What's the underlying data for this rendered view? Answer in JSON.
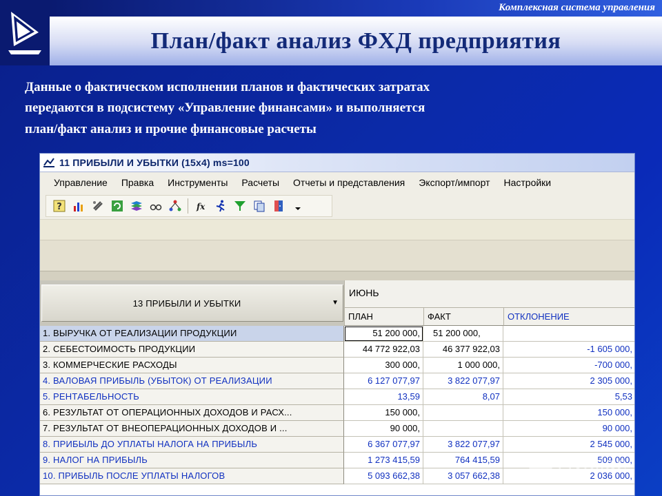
{
  "slide": {
    "tagline": "Комплексная система управления",
    "title": "План/факт анализ  ФХД предприятия",
    "intro": [
      "Данные о фактическом исполнении планов и фактических затратах",
      "передаются в подсистему «Управление финансами» и выполняется",
      "план/факт анализ и прочие финансовые расчеты"
    ],
    "watermark": "MySlide"
  },
  "window": {
    "title": "11 ПРИБЫЛИ И УБЫТКИ (15x4) ms=100",
    "menu": [
      "Управление",
      "Правка",
      "Инструменты",
      "Расчеты",
      "Отчеты и представления",
      "Экспорт/импорт",
      "Настройки"
    ]
  },
  "toolbar": {
    "icons": [
      "help-icon",
      "chart-icon",
      "link-icon",
      "refresh-icon",
      "layers-icon",
      "glasses-icon",
      "tree-icon",
      "function-icon",
      "run-icon",
      "filter-icon",
      "copy-icon",
      "door-icon",
      "dropdown-arrow-icon"
    ],
    "fx": "fx"
  },
  "grid": {
    "dimension": "13 ПРИБЫЛИ И УБЫТКИ",
    "month": "ИЮНЬ",
    "columns": {
      "plan": "ПЛАН",
      "fact": "ФАКТ",
      "dev": "ОТКЛОНЕНИЕ"
    },
    "rows": [
      {
        "label": "1. ВЫРУЧКА ОТ РЕАЛИЗАЦИИ ПРОДУКЦИИ",
        "plan": "51 200 000,",
        "fact": "51 200 000,",
        "dev": ""
      },
      {
        "label": "2. СЕБЕСТОИМОСТЬ ПРОДУКЦИИ",
        "plan": "44 772 922,03",
        "fact": "46 377 922,03",
        "dev": "-1 605 000,"
      },
      {
        "label": "3. КОММЕРЧЕСКИЕ РАСХОДЫ",
        "plan": "300 000,",
        "fact": "1 000 000,",
        "dev": "-700 000,"
      },
      {
        "label": "4. ВАЛОВАЯ ПРИБЫЛЬ (УБЫТОК) ОТ РЕАЛИЗАЦИИ",
        "plan": "6 127 077,97",
        "fact": "3 822 077,97",
        "dev": "2 305 000,"
      },
      {
        "label": "5. РЕНТАБЕЛЬНОСТЬ",
        "plan": "13,59",
        "fact": "8,07",
        "dev": "5,53"
      },
      {
        "label": "6. РЕЗУЛЬТАТ ОТ ОПЕРАЦИОННЫХ ДОХОДОВ И РАСХ...",
        "plan": "150 000,",
        "fact": "",
        "dev": "150 000,"
      },
      {
        "label": "7. РЕЗУЛЬТАТ ОТ ВНЕОПЕРАЦИОННЫХ ДОХОДОВ И ...",
        "plan": "90 000,",
        "fact": "",
        "dev": "90 000,"
      },
      {
        "label": "8. ПРИБЫЛЬ ДО УПЛАТЫ НАЛОГА НА ПРИБЫЛЬ",
        "plan": "6 367 077,97",
        "fact": "3 822 077,97",
        "dev": "2 545 000,"
      },
      {
        "label": "9. НАЛОГ НА ПРИБЫЛЬ",
        "plan": "1 273 415,59",
        "fact": "764 415,59",
        "dev": "509 000,"
      },
      {
        "label": "10. ПРИБЫЛЬ ПОСЛЕ УПЛАТЫ НАЛОГОВ",
        "plan": "5 093 662,38",
        "fact": "3 057 662,38",
        "dev": "2 036 000,"
      }
    ]
  },
  "colors": {
    "background": "#0b2aa8",
    "title_text": "#132a78",
    "grid_blue_text": "#1030c0",
    "selection": "#c9d4ea"
  }
}
